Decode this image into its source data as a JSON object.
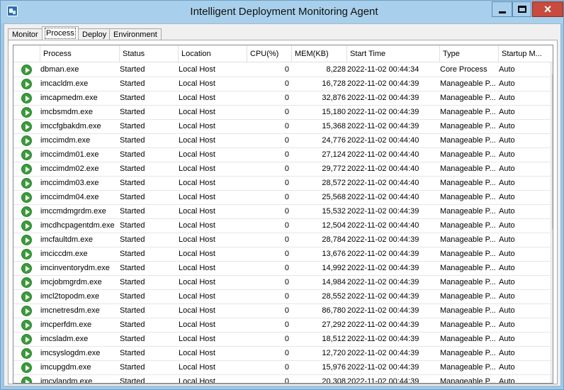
{
  "window": {
    "title": "Intelligent Deployment Monitoring Agent",
    "close_glyph": "×"
  },
  "tabs": [
    {
      "label": "Monitor"
    },
    {
      "label": "Process"
    },
    {
      "label": "Deploy"
    },
    {
      "label": "Environment"
    }
  ],
  "active_tab": "Process",
  "table": {
    "columns": [
      "Process",
      "Status",
      "Location",
      "CPU(%)",
      "MEM(KB)",
      "Start Time",
      "Type",
      "Startup M..."
    ],
    "rows": [
      {
        "process": "dbman.exe",
        "status": "Started",
        "location": "Local Host",
        "cpu": "0",
        "mem": "8,228",
        "start": "2022-11-02 00:44:34",
        "type": "Core Process",
        "startup": "Auto"
      },
      {
        "process": "imcacldm.exe",
        "status": "Started",
        "location": "Local Host",
        "cpu": "0",
        "mem": "16,728",
        "start": "2022-11-02 00:44:39",
        "type": "Manageable P...",
        "startup": "Auto"
      },
      {
        "process": "imcapmedm.exe",
        "status": "Started",
        "location": "Local Host",
        "cpu": "0",
        "mem": "32,876",
        "start": "2022-11-02 00:44:39",
        "type": "Manageable P...",
        "startup": "Auto"
      },
      {
        "process": "imcbsmdm.exe",
        "status": "Started",
        "location": "Local Host",
        "cpu": "0",
        "mem": "15,180",
        "start": "2022-11-02 00:44:39",
        "type": "Manageable P...",
        "startup": "Auto"
      },
      {
        "process": "imccfgbakdm.exe",
        "status": "Started",
        "location": "Local Host",
        "cpu": "0",
        "mem": "15,368",
        "start": "2022-11-02 00:44:39",
        "type": "Manageable P...",
        "startup": "Auto"
      },
      {
        "process": "imccimdm.exe",
        "status": "Started",
        "location": "Local Host",
        "cpu": "0",
        "mem": "24,776",
        "start": "2022-11-02 00:44:40",
        "type": "Manageable P...",
        "startup": "Auto"
      },
      {
        "process": "imccimdm01.exe",
        "status": "Started",
        "location": "Local Host",
        "cpu": "0",
        "mem": "27,124",
        "start": "2022-11-02 00:44:40",
        "type": "Manageable P...",
        "startup": "Auto"
      },
      {
        "process": "imccimdm02.exe",
        "status": "Started",
        "location": "Local Host",
        "cpu": "0",
        "mem": "29,772",
        "start": "2022-11-02 00:44:40",
        "type": "Manageable P...",
        "startup": "Auto"
      },
      {
        "process": "imccimdm03.exe",
        "status": "Started",
        "location": "Local Host",
        "cpu": "0",
        "mem": "28,572",
        "start": "2022-11-02 00:44:40",
        "type": "Manageable P...",
        "startup": "Auto"
      },
      {
        "process": "imccimdm04.exe",
        "status": "Started",
        "location": "Local Host",
        "cpu": "0",
        "mem": "25,568",
        "start": "2022-11-02 00:44:40",
        "type": "Manageable P...",
        "startup": "Auto"
      },
      {
        "process": "imccmdmgrdm.exe",
        "status": "Started",
        "location": "Local Host",
        "cpu": "0",
        "mem": "15,532",
        "start": "2022-11-02 00:44:39",
        "type": "Manageable P...",
        "startup": "Auto"
      },
      {
        "process": "imcdhcpagentdm.exe",
        "status": "Started",
        "location": "Local Host",
        "cpu": "0",
        "mem": "12,504",
        "start": "2022-11-02 00:44:40",
        "type": "Manageable P...",
        "startup": "Auto"
      },
      {
        "process": "imcfaultdm.exe",
        "status": "Started",
        "location": "Local Host",
        "cpu": "0",
        "mem": "28,784",
        "start": "2022-11-02 00:44:39",
        "type": "Manageable P...",
        "startup": "Auto"
      },
      {
        "process": "imciccdm.exe",
        "status": "Started",
        "location": "Local Host",
        "cpu": "0",
        "mem": "13,676",
        "start": "2022-11-02 00:44:39",
        "type": "Manageable P...",
        "startup": "Auto"
      },
      {
        "process": "imcinventorydm.exe",
        "status": "Started",
        "location": "Local Host",
        "cpu": "0",
        "mem": "14,992",
        "start": "2022-11-02 00:44:39",
        "type": "Manageable P...",
        "startup": "Auto"
      },
      {
        "process": "imcjobmgrdm.exe",
        "status": "Started",
        "location": "Local Host",
        "cpu": "0",
        "mem": "14,984",
        "start": "2022-11-02 00:44:39",
        "type": "Manageable P...",
        "startup": "Auto"
      },
      {
        "process": "imcl2topodm.exe",
        "status": "Started",
        "location": "Local Host",
        "cpu": "0",
        "mem": "28,552",
        "start": "2022-11-02 00:44:39",
        "type": "Manageable P...",
        "startup": "Auto"
      },
      {
        "process": "imcnetresdm.exe",
        "status": "Started",
        "location": "Local Host",
        "cpu": "0",
        "mem": "86,780",
        "start": "2022-11-02 00:44:39",
        "type": "Manageable P...",
        "startup": "Auto"
      },
      {
        "process": "imcperfdm.exe",
        "status": "Started",
        "location": "Local Host",
        "cpu": "0",
        "mem": "27,292",
        "start": "2022-11-02 00:44:39",
        "type": "Manageable P...",
        "startup": "Auto"
      },
      {
        "process": "imcsladm.exe",
        "status": "Started",
        "location": "Local Host",
        "cpu": "0",
        "mem": "18,512",
        "start": "2022-11-02 00:44:39",
        "type": "Manageable P...",
        "startup": "Auto"
      },
      {
        "process": "imcsyslogdm.exe",
        "status": "Started",
        "location": "Local Host",
        "cpu": "0",
        "mem": "12,720",
        "start": "2022-11-02 00:44:39",
        "type": "Manageable P...",
        "startup": "Auto"
      },
      {
        "process": "imcupgdm.exe",
        "status": "Started",
        "location": "Local Host",
        "cpu": "0",
        "mem": "15,976",
        "start": "2022-11-02 00:44:39",
        "type": "Manageable P...",
        "startup": "Auto"
      },
      {
        "process": "imcvlandm.exe",
        "status": "Started",
        "location": "Local Host",
        "cpu": "0",
        "mem": "20,308",
        "start": "2022-11-02 00:44:39",
        "type": "Manageable P...",
        "startup": "Auto"
      }
    ]
  },
  "scrollbar": {
    "up_glyph": "⌃",
    "down_glyph": "⌄"
  },
  "colors": {
    "title_bar": "#a8d0ec",
    "close_button": "#c74b3f",
    "started_icon": "#3b9b3b"
  },
  "icons": {
    "app": "monitoring-agent-icon",
    "status": "started-process-icon"
  }
}
